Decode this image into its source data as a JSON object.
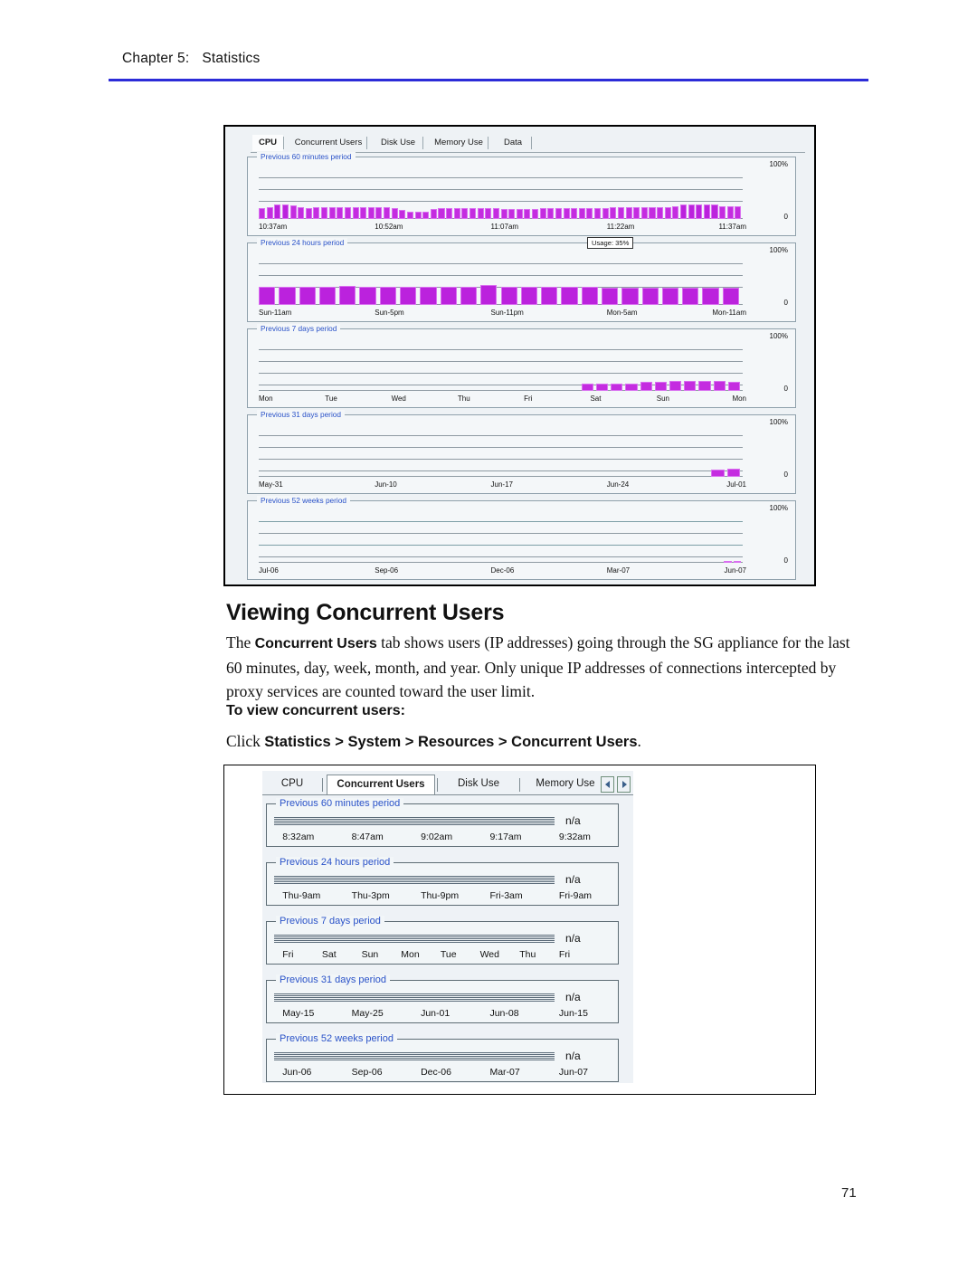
{
  "running_head": {
    "chapter": "Chapter 5:",
    "title": "Statistics"
  },
  "page_number": "71",
  "heading": "Viewing Concurrent Users",
  "body_paragraph": {
    "part1": "The ",
    "bold1": "Concurrent Users",
    "part2": " tab shows users (IP addresses) going through the SG appliance for the last 60 minutes, day, week, month, and year. Only unique IP addresses of connections intercepted by proxy services are counted toward the user limit."
  },
  "procedure_heading": "To view concurrent users:",
  "procedure_step": {
    "prefix": "Click ",
    "path": "Statistics > System > Resources > Concurrent Users",
    "suffix": "."
  },
  "figure_cpu": {
    "tabs": [
      {
        "label": "CPU",
        "selected": true
      },
      {
        "label": "Concurrent Users",
        "selected": false
      },
      {
        "label": "Disk Use",
        "selected": false
      },
      {
        "label": "Memory Use",
        "selected": false
      },
      {
        "label": "Data",
        "selected": false
      }
    ],
    "tooltip": "Usage: 35%",
    "y_top": "100%",
    "y_bottom": "0",
    "panels": [
      {
        "legend": "Previous 60 minutes period",
        "ticks": [
          "10:37am",
          "10:52am",
          "11:07am",
          "11:22am",
          "11:37am"
        ]
      },
      {
        "legend": "Previous 24 hours period",
        "ticks": [
          "Sun-11am",
          "Sun-5pm",
          "Sun-11pm",
          "Mon-5am",
          "Mon-11am"
        ]
      },
      {
        "legend": "Previous 7 days period",
        "ticks": [
          "Mon",
          "Tue",
          "Wed",
          "Thu",
          "Fri",
          "Sat",
          "Sun",
          "Mon"
        ]
      },
      {
        "legend": "Previous 31 days period",
        "ticks": [
          "May-31",
          "Jun-10",
          "Jun-17",
          "Jun-24",
          "Jul-01"
        ]
      },
      {
        "legend": "Previous 52 weeks period",
        "ticks": [
          "Jul-06",
          "Sep-06",
          "Dec-06",
          "Mar-07",
          "Jun-07"
        ]
      }
    ]
  },
  "figure_concurrent_users": {
    "tabs": [
      {
        "label": "CPU",
        "selected": false
      },
      {
        "label": "Concurrent Users",
        "selected": true
      },
      {
        "label": "Disk Use",
        "selected": false
      },
      {
        "label": "Memory Use",
        "selected": false
      }
    ],
    "value_label": "n/a",
    "panels": [
      {
        "legend": "Previous 60 minutes period",
        "ticks": [
          "8:32am",
          "8:47am",
          "9:02am",
          "9:17am",
          "9:32am"
        ]
      },
      {
        "legend": "Previous 24 hours period",
        "ticks": [
          "Thu-9am",
          "Thu-3pm",
          "Thu-9pm",
          "Fri-3am",
          "Fri-9am"
        ]
      },
      {
        "legend": "Previous 7 days period",
        "ticks": [
          "Fri",
          "Sat",
          "Sun",
          "Mon",
          "Tue",
          "Wed",
          "Thu",
          "Fri"
        ]
      },
      {
        "legend": "Previous 31 days period",
        "ticks": [
          "May-15",
          "May-25",
          "Jun-01",
          "Jun-08",
          "Jun-15"
        ]
      },
      {
        "legend": "Previous 52 weeks period",
        "ticks": [
          "Jun-06",
          "Sep-06",
          "Dec-06",
          "Mar-07",
          "Jun-07"
        ]
      }
    ]
  },
  "chart_data": [
    {
      "type": "bar",
      "title": "Previous 60 minutes period",
      "ylabel": "",
      "xlabel": "",
      "ylim": [
        0,
        100
      ],
      "tick_labels": [
        "10:37am",
        "10:52am",
        "11:07am",
        "11:22am",
        "11:37am"
      ],
      "values": [
        20,
        21,
        27,
        27,
        25,
        21,
        20,
        21,
        21,
        22,
        21,
        21,
        21,
        21,
        21,
        21,
        21,
        20,
        17,
        14,
        13,
        14,
        18,
        20,
        20,
        20,
        20,
        20,
        20,
        20,
        20,
        19,
        19,
        19,
        19,
        19,
        20,
        20,
        20,
        20,
        20,
        20,
        20,
        20,
        20,
        21,
        21,
        21,
        21,
        21,
        21,
        22,
        22,
        23,
        26,
        27,
        27,
        26,
        26,
        24,
        23,
        24
      ]
    },
    {
      "type": "bar",
      "title": "Previous 24 hours period",
      "ylim": [
        0,
        100
      ],
      "tooltip": "Usage: 35%",
      "tick_labels": [
        "Sun-11am",
        "Sun-5pm",
        "Sun-11pm",
        "Mon-5am",
        "Mon-11am"
      ],
      "values": [
        33,
        33,
        33,
        33,
        35,
        33,
        33,
        33,
        33,
        33,
        34,
        36,
        33,
        33,
        33,
        33,
        33,
        32,
        32,
        31,
        31,
        31,
        31,
        31
      ]
    },
    {
      "type": "bar",
      "title": "Previous 7 days period",
      "ylim": [
        0,
        100
      ],
      "tick_labels": [
        "Mon",
        "Tue",
        "Wed",
        "Thu",
        "Fri",
        "Sat",
        "Sun",
        "Mon"
      ],
      "values": [
        0,
        0,
        0,
        0,
        0,
        0,
        0,
        0,
        0,
        0,
        0,
        0,
        0,
        0,
        0,
        0,
        0,
        0,
        0,
        0,
        0,
        0,
        14,
        14,
        13,
        14,
        17,
        17,
        18,
        18,
        18,
        18,
        17
      ]
    },
    {
      "type": "bar",
      "title": "Previous 31 days period",
      "ylim": [
        0,
        100
      ],
      "tick_labels": [
        "May-31",
        "Jun-10",
        "Jun-17",
        "Jun-24",
        "Jul-01"
      ],
      "values": [
        0,
        0,
        0,
        0,
        0,
        0,
        0,
        0,
        0,
        0,
        0,
        0,
        0,
        0,
        0,
        0,
        0,
        0,
        0,
        0,
        0,
        0,
        0,
        0,
        0,
        0,
        0,
        0,
        0,
        14,
        15
      ]
    },
    {
      "type": "bar",
      "title": "Previous 52 weeks period",
      "ylim": [
        0,
        100
      ],
      "tick_labels": [
        "Jul-06",
        "Sep-06",
        "Dec-06",
        "Mar-07",
        "Jun-07"
      ],
      "values": [
        0,
        0,
        0,
        0,
        0,
        0,
        0,
        0,
        0,
        0,
        0,
        0,
        0,
        0,
        0,
        0,
        0,
        0,
        0,
        0,
        0,
        0,
        0,
        0,
        0,
        0,
        0,
        0,
        0,
        0,
        0,
        0,
        0,
        0,
        0,
        0,
        0,
        0,
        0,
        0,
        0,
        0,
        0,
        0,
        0,
        0,
        0,
        0,
        0,
        0,
        1,
        1
      ]
    }
  ],
  "colors": {
    "bar": "#c42ce0",
    "legend_text": "#2a52c8",
    "rule": "#2c2cd8",
    "grid": "#8e9aa2"
  }
}
